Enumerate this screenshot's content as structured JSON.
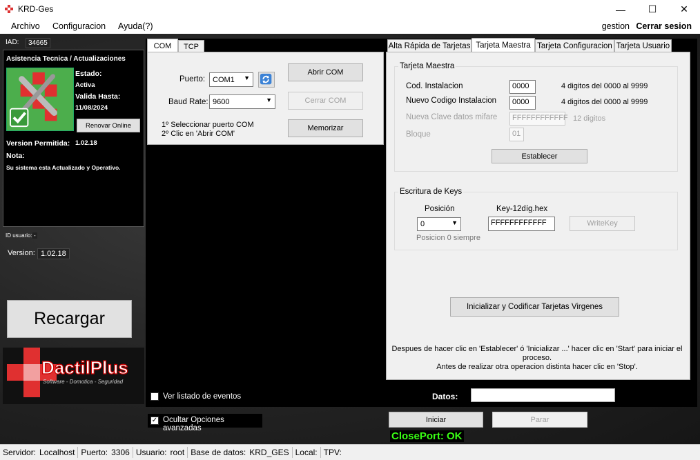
{
  "window": {
    "title": "KRD-Ges",
    "minimize": "—",
    "maximize": "☐",
    "close": "✕"
  },
  "menu": {
    "items": [
      "Archivo",
      "Configuracion",
      "Ayuda(?)"
    ],
    "user": "gestion",
    "logout": "Cerrar sesion"
  },
  "left": {
    "iad_label": "IAD:",
    "iad_value": "34665",
    "panel_title": "Asistencia Tecnica / Actualizaciones",
    "estado_label": "Estado:",
    "estado_value": "Activa",
    "valida_label": "Valida Hasta:",
    "valida_value": "11/08/2024",
    "renew_button": "Renovar Online",
    "version_permitida_label": "Version Permitida:",
    "version_permitida_value": "1.02.18",
    "nota_label": "Nota:",
    "nota_value": "Su sistema esta Actualizado y Operativo.",
    "id_usuario_label": "ID usuario:",
    "id_usuario_value": "-",
    "version_label": "Version:",
    "version_value": "1.02.18",
    "reload_button": "Recargar",
    "logo_text": "DactilPlus",
    "logo_tagline": "Software - Domotica - Seguridad"
  },
  "center": {
    "tabs": [
      "COM",
      "TCP"
    ],
    "puerto_label": "Puerto:",
    "puerto_value": "COM1",
    "baud_label": "Baud Rate:",
    "baud_value": "9600",
    "open_button": "Abrir COM",
    "close_button": "Cerrar COM",
    "memorize_button": "Memorizar",
    "instruction_1": "1º Seleccionar puerto COM",
    "instruction_2": "2º Clic en 'Abrir COM'",
    "show_events_label": "Ver listado de eventos",
    "hide_advanced_label": "Ocultar Opciones avanzadas",
    "hide_advanced_checked": true
  },
  "right": {
    "tabs": [
      "Alta Rápida de Tarjetas",
      "Tarjeta Maestra",
      "Tarjeta Configuracion",
      "Tarjeta Usuario"
    ],
    "active_tab": "Tarjeta Maestra",
    "master_group_title": "Tarjeta Maestra",
    "cod_label": "Cod. Instalacion",
    "cod_value": "0000",
    "cod_hint": "4 digitos del 0000 al 9999",
    "new_cod_label": "Nuevo Codigo Instalacion",
    "new_cod_value": "0000",
    "new_cod_hint": "4 digitos del 0000 al 9999",
    "mifare_label": "Nueva Clave datos mifare",
    "mifare_value": "FFFFFFFFFFFF",
    "mifare_hint": "12 digitos",
    "bloque_label": "Bloque",
    "bloque_value": "01",
    "establish_button": "Establecer",
    "keys_group_title": "Escritura de Keys",
    "posicion_label": "Posición",
    "posicion_value": "0",
    "posicion_hint": "Posicion 0 siempre",
    "key_label": "Key-12díg.hex",
    "key_value": "FFFFFFFFFFFF",
    "writekey_button": "WriteKey",
    "init_button": "Inicializar y Codificar Tarjetas Virgenes",
    "note_line1": "Despues de hacer clic en 'Establecer' ó 'Inicializar ...' hacer clic en 'Start' para iniciar el proceso.",
    "note_line2": "Antes de realizar otra operacion distinta hacer clic en 'Stop'."
  },
  "bottom": {
    "datos_label": "Datos:",
    "datos_value": "",
    "start_button": "Iniciar",
    "stop_button": "Parar",
    "status": "ClosePort: OK"
  },
  "statusbar": {
    "servidor_label": "Servidor:",
    "servidor_value": "Localhost",
    "puerto_label": "Puerto:",
    "puerto_value": "3306",
    "usuario_label": "Usuario:",
    "usuario_value": "root",
    "bd_label": "Base de datos:",
    "bd_value": "KRD_GES",
    "local_label": "Local:",
    "local_value": "",
    "tpv_label": "TPV:",
    "tpv_value": ""
  },
  "colors": {
    "status_ok": "#39ff14",
    "dark_bg": "#1e1e1e",
    "panel_gray": "#f0f0f0"
  }
}
